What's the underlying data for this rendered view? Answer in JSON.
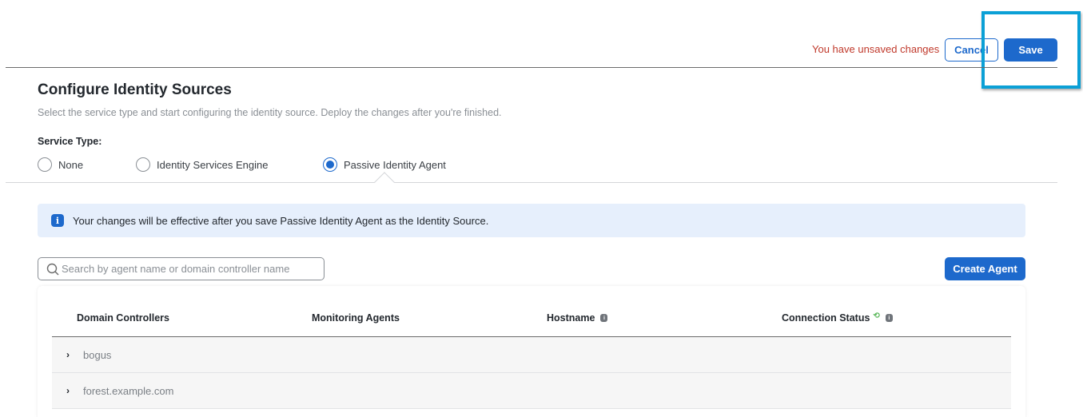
{
  "header": {
    "unsaved_message": "You have unsaved changes",
    "cancel_label": "Cancel",
    "save_label": "Save"
  },
  "page": {
    "title": "Configure Identity Sources",
    "subtitle": "Select the service type and start configuring the identity source. Deploy the changes after you're finished.",
    "service_type_label": "Service Type:",
    "service_types": [
      {
        "label": "None",
        "checked": false
      },
      {
        "label": "Identity Services Engine",
        "checked": false
      },
      {
        "label": "Passive Identity Agent",
        "checked": true
      }
    ]
  },
  "banner": {
    "icon": "info-icon",
    "message": "Your changes will be effective after you save Passive Identity Agent as the Identity Source."
  },
  "search": {
    "placeholder": "Search by agent name or domain controller name",
    "value": ""
  },
  "create_agent_label": "Create Agent",
  "table": {
    "columns": [
      {
        "label": "Domain Controllers"
      },
      {
        "label": "Monitoring Agents"
      },
      {
        "label": "Hostname",
        "info_icon": true
      },
      {
        "label": "Connection Status",
        "refresh_icon": true,
        "info_icon": true
      }
    ],
    "rows": [
      {
        "domain_controller": "bogus",
        "expanded": false
      },
      {
        "domain_controller": "forest.example.com",
        "expanded": false
      }
    ]
  },
  "colors": {
    "primary": "#1d69cc",
    "warning_text": "#c0392b",
    "highlight_border": "#0ba0d6",
    "info_banner_bg": "#e6effc",
    "refresh_icon": "#5cb85c"
  }
}
